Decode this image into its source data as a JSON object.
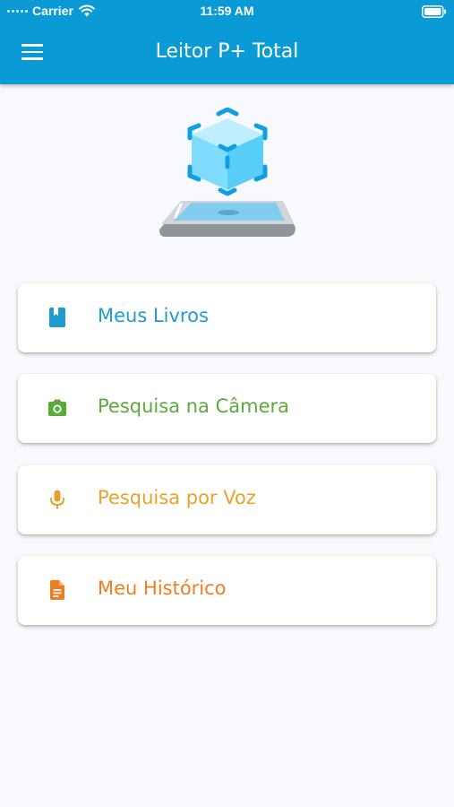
{
  "status_bar": {
    "carrier": "Carrier",
    "time": "11:59 AM"
  },
  "app_bar": {
    "title": "Leitor P+ Total",
    "menu_icon": "hamburger-menu-icon"
  },
  "menu": [
    {
      "label": "Meus Livros",
      "icon": "book-icon",
      "color": "#1f9bd1"
    },
    {
      "label": "Pesquisa na Câmera",
      "icon": "camera-icon",
      "color": "#5aaa3c"
    },
    {
      "label": "Pesquisa por Voz",
      "icon": "microphone-icon",
      "color": "#e8a22a"
    },
    {
      "label": "Meu Histórico",
      "icon": "document-icon",
      "color": "#ef7d22"
    }
  ],
  "theme": {
    "primary": "#0a9ad6",
    "background": "#f7f9fc"
  }
}
